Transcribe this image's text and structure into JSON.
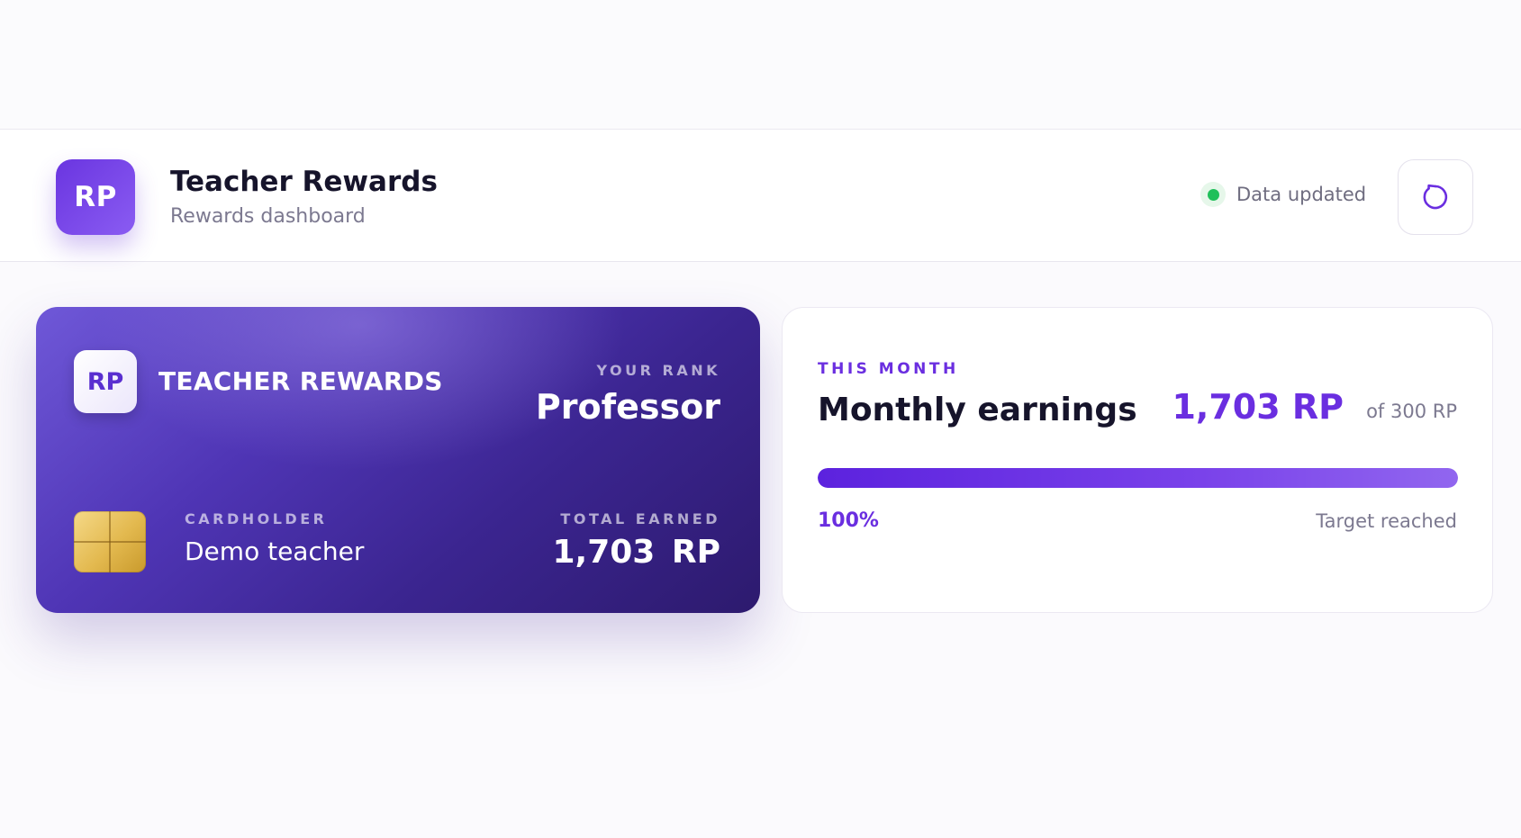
{
  "header": {
    "logo_text": "RP",
    "title": "Teacher Rewards",
    "subtitle": "Rewards dashboard",
    "status_text": "Data updated",
    "status_color": "#20c05a",
    "refresh_icon": "refresh-icon"
  },
  "card": {
    "logo_text": "RP",
    "brand": "TEACHER REWARDS",
    "rank_label": "YOUR RANK",
    "rank_value": "Professor",
    "chip_icon": "card-chip-icon",
    "cardholder_label": "CARDHOLDER",
    "cardholder_value": "Demo teacher",
    "total_label": "TOTAL EARNED",
    "total_value": "1,703 RP"
  },
  "monthly": {
    "eyebrow": "THIS MONTH",
    "title": "Monthly earnings",
    "amount": "1,703 RP",
    "target": "of 300 RP",
    "progress_fraction": 1.0,
    "progress_label": "100%",
    "progress_status": "Target reached"
  },
  "colors": {
    "accent": "#6a2ee0",
    "card_gradient_start": "#6f58d8",
    "card_gradient_end": "#2d1a6e"
  }
}
